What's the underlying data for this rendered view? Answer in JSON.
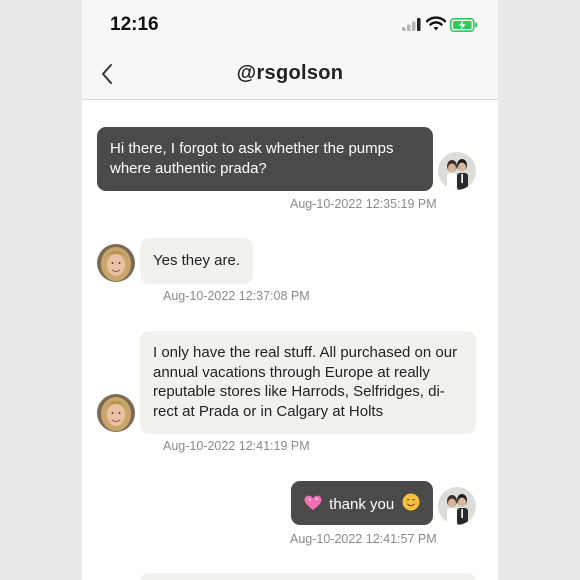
{
  "status_bar": {
    "time": "12:16"
  },
  "header": {
    "title": "@rsgolson"
  },
  "messages": [
    {
      "direction": "outgoing",
      "text": "Hi there, I forgot to ask whether the pumps where authentic prada?",
      "timestamp": "Aug-10-2022 12:35:19 PM"
    },
    {
      "direction": "incoming",
      "text": "Yes they are.",
      "timestamp": "Aug-10-2022 12:37:08 PM"
    },
    {
      "direction": "incoming",
      "text": "I only have the real stuff. All purchased on our annual vacations through Europe at really reputable stores like Harrods, Selfridges, di-rect at Prada or in Calgary at Holts",
      "timestamp": "Aug-10-2022 12:41:19 PM"
    },
    {
      "direction": "outgoing",
      "text": "thank you",
      "timestamp": "Aug-10-2022 12:41:57 PM"
    }
  ],
  "colors": {
    "outgoing_bubble": "#4a4a4a",
    "incoming_bubble": "#f2f1ee",
    "timestamp": "#8a8a8a",
    "battery": "#34c759"
  },
  "icons": [
    "back-chevron-icon",
    "cellular-signal-icon",
    "wifi-icon",
    "battery-charging-icon",
    "heart-emoji-icon",
    "smile-emoji-icon"
  ]
}
